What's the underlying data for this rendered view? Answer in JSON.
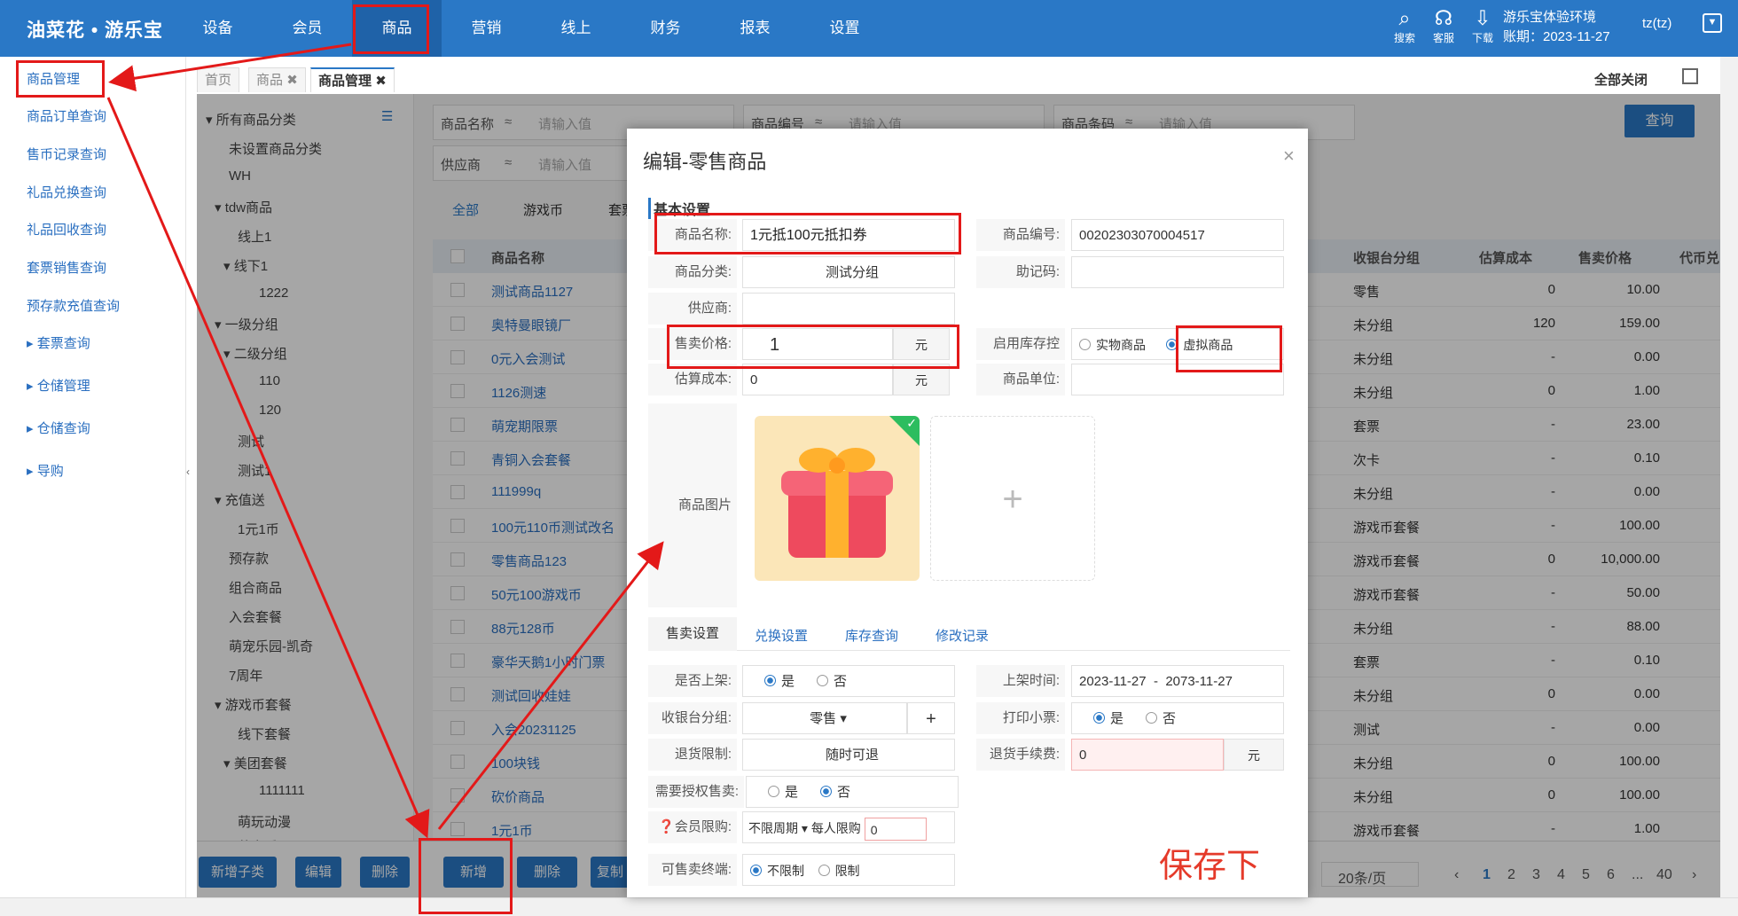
{
  "app": {
    "logo": "油菜花 • 游乐宝"
  },
  "nav": [
    "设备",
    "会员",
    "商品",
    "营销",
    "线上",
    "财务",
    "报表",
    "设置"
  ],
  "topbar": {
    "icons": [
      {
        "icon": "search-icon",
        "label": "搜索"
      },
      {
        "icon": "headset-icon",
        "label": "客服"
      },
      {
        "icon": "download-icon",
        "label": "下载"
      }
    ],
    "env": "游乐宝体验环境",
    "period": "账期：2023-11-27",
    "user": "tz(tz)"
  },
  "sidebar": [
    "商品管理",
    "商品订单查询",
    "售币记录查询",
    "礼品兑换查询",
    "礼品回收查询",
    "套票销售查询",
    "预存款充值查询",
    "套票查询",
    "仓储管理",
    "仓储查询",
    "导购"
  ],
  "tabs": [
    "首页",
    "商品",
    "商品管理"
  ],
  "tab_actions": {
    "close_all": "全部关闭"
  },
  "tree": [
    "所有商品分类",
    "未设置商品分类",
    "WH",
    "tdw商品",
    "线上1",
    "线下1",
    "1222",
    "一级分组",
    "二级分组",
    "110",
    "120",
    "测试",
    "测试1",
    "充值送",
    "1元1币",
    "预存款",
    "组合商品",
    "入会套餐",
    "萌宠乐园-凯奇",
    "7周年",
    "游戏币套餐",
    "线下套餐",
    "美团套餐",
    "1111111",
    "萌玩动漫",
    "萌宠乐园"
  ],
  "search": {
    "fields": [
      {
        "label": "商品名称",
        "op": "≈",
        "placeholder": "请输入值"
      },
      {
        "label": "商品编号",
        "op": "≈",
        "placeholder": "请输入值"
      },
      {
        "label": "商品条码",
        "op": "≈",
        "placeholder": "请输入值"
      },
      {
        "label": "供应商",
        "op": "≈",
        "placeholder": "请输入值"
      }
    ],
    "query_label": "查询"
  },
  "subtabs": [
    "全部",
    "游戏币",
    "套票"
  ],
  "table": {
    "headers": {
      "name": "商品名称",
      "group": "收银台分组",
      "cost": "估算成本",
      "price": "售卖价格",
      "proxy": "代币兑"
    },
    "rows": [
      {
        "name": "测试商品1127",
        "group": "零售",
        "cost": "0",
        "price": "10.00"
      },
      {
        "name": "奥特曼眼镜厂",
        "group": "未分组",
        "cost": "120",
        "price": "159.00"
      },
      {
        "name": "0元入会测试",
        "group": "未分组",
        "cost": "-",
        "price": "0.00"
      },
      {
        "name": "1126测速",
        "group": "未分组",
        "cost": "0",
        "price": "1.00"
      },
      {
        "name": "萌宠期限票",
        "group": "套票",
        "cost": "-",
        "price": "23.00"
      },
      {
        "name": "青铜入会套餐",
        "group": "次卡",
        "cost": "-",
        "price": "0.10"
      },
      {
        "name": "111999q",
        "group": "未分组",
        "cost": "-",
        "price": "0.00"
      },
      {
        "name": "100元110币测试改名",
        "group": "游戏币套餐",
        "cost": "-",
        "price": "100.00"
      },
      {
        "name": "零售商品123",
        "group": "游戏币套餐",
        "cost": "0",
        "price": "10,000.00"
      },
      {
        "name": "50元100游戏币",
        "group": "游戏币套餐",
        "cost": "-",
        "price": "50.00"
      },
      {
        "name": "88元128币",
        "group": "未分组",
        "cost": "-",
        "price": "88.00"
      },
      {
        "name": "豪华天鹅1小时门票",
        "group": "套票",
        "cost": "-",
        "price": "0.10"
      },
      {
        "name": "测试回收娃娃",
        "group": "未分组",
        "cost": "0",
        "price": "0.00"
      },
      {
        "name": "入会20231125",
        "group": "测试",
        "cost": "-",
        "price": "0.00"
      },
      {
        "name": "100块钱",
        "group": "未分组",
        "cost": "0",
        "price": "100.00"
      },
      {
        "name": "砍价商品",
        "group": "未分组",
        "cost": "0",
        "price": "100.00"
      },
      {
        "name": "1元1币",
        "group": "游戏币套餐",
        "cost": "-",
        "price": "1.00"
      }
    ]
  },
  "bottom_buttons": [
    "新增子类",
    "编辑",
    "删除",
    "新增",
    "删除",
    "复制"
  ],
  "pager": {
    "size": "20条/页",
    "pages": [
      "1",
      "2",
      "3",
      "4",
      "5",
      "6",
      "...",
      "40"
    ],
    "current": "1"
  },
  "modal": {
    "title": "编辑-零售商品",
    "section": "基本设置",
    "fields": {
      "name": {
        "label": "商品名称:",
        "value": "1元抵100元抵扣券"
      },
      "code": {
        "label": "商品编号:",
        "value": "00202303070004517"
      },
      "category": {
        "label": "商品分类:",
        "value": "测试分组"
      },
      "mnemonic": {
        "label": "助记码:",
        "value": ""
      },
      "supplier": {
        "label": "供应商:",
        "value": ""
      },
      "price": {
        "label": "售卖价格:",
        "value": "1",
        "unit": "元"
      },
      "stock_control": {
        "label": "启用库存控制:",
        "options": [
          "实物商品",
          "虚拟商品"
        ],
        "selected": "虚拟商品"
      },
      "cost": {
        "label": "估算成本:",
        "value": "0",
        "unit": "元"
      },
      "unit_field": {
        "label": "商品单位:",
        "value": ""
      },
      "image": {
        "label": "商品图片"
      }
    },
    "tabs": [
      "售卖设置",
      "兑换设置",
      "库存查询",
      "修改记录"
    ],
    "sale": {
      "on_shelf": {
        "label": "是否上架:",
        "options": [
          "是",
          "否"
        ],
        "selected": "是"
      },
      "shelf_time": {
        "label": "上架时间:",
        "start": "2023-11-27",
        "sep": "-",
        "end": "2073-11-27"
      },
      "cashier_group": {
        "label": "收银台分组:",
        "value": "零售"
      },
      "print_receipt": {
        "label": "打印小票:",
        "options": [
          "是",
          "否"
        ],
        "selected": "是"
      },
      "return_limit": {
        "label": "退货限制:",
        "value": "随时可退"
      },
      "return_fee": {
        "label": "退货手续费:",
        "value": "0",
        "unit": "元"
      },
      "need_auth": {
        "label": "需要授权售卖:",
        "options": [
          "是",
          "否"
        ],
        "selected": "否"
      },
      "member_limit": {
        "label": "❓会员限购:",
        "period": "不限周期",
        "per_person_label": "每人限购",
        "per_person": "0"
      },
      "terminal": {
        "label": "可售卖终端:",
        "options": [
          "不限制",
          "限制"
        ],
        "selected": "不限制"
      }
    }
  },
  "annotation": "保存下"
}
